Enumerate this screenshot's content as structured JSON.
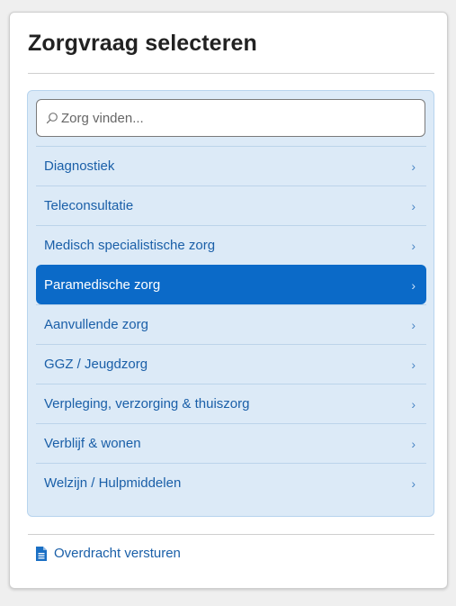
{
  "title": "Zorgvraag selecteren",
  "search": {
    "placeholder": "Zorg vinden...",
    "icon": "search-icon"
  },
  "categories": [
    {
      "label": "Diagnostiek",
      "active": false
    },
    {
      "label": "Teleconsultatie",
      "active": false
    },
    {
      "label": "Medisch specialistische zorg",
      "active": false
    },
    {
      "label": "Paramedische zorg",
      "active": true
    },
    {
      "label": "Aanvullende zorg",
      "active": false
    },
    {
      "label": "GGZ / Jeugdzorg",
      "active": false
    },
    {
      "label": "Verpleging, verzorging & thuiszorg",
      "active": false
    },
    {
      "label": "Verblijf & wonen",
      "active": false
    },
    {
      "label": "Welzijn / Hulpmiddelen",
      "active": false
    }
  ],
  "chevron": "›",
  "footer": {
    "link_label": "Overdracht versturen",
    "icon": "document-icon"
  },
  "colors": {
    "accent": "#0b6ac8",
    "link": "#1a5fa8",
    "panel_bg": "#dceaf7"
  }
}
